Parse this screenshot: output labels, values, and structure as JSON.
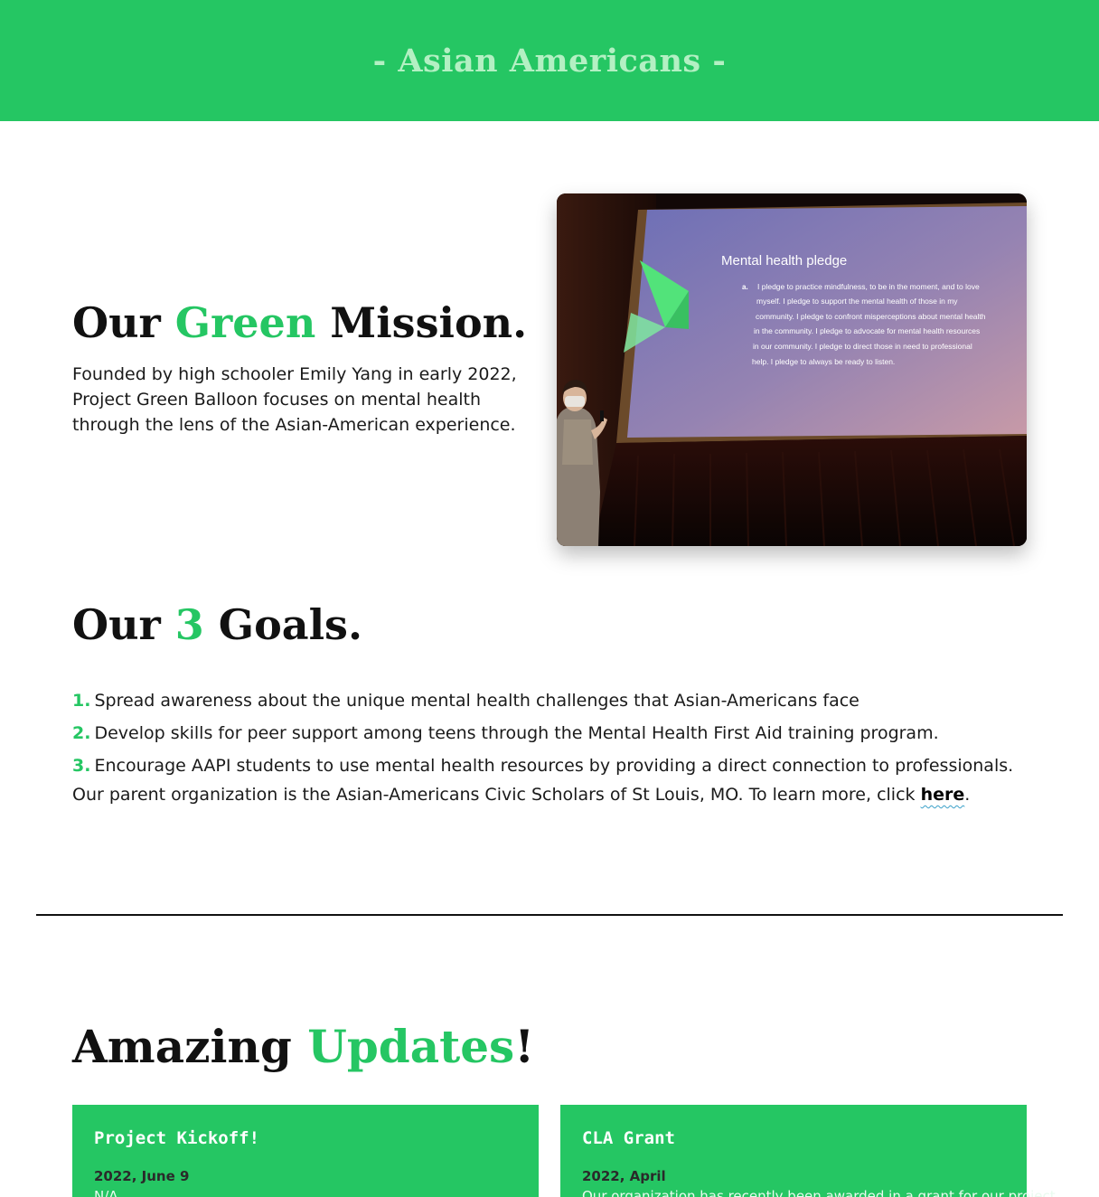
{
  "banner": {
    "title": "- Asian Americans -"
  },
  "mission": {
    "heading_pre": "Our ",
    "heading_accent": "Green",
    "heading_post": " Mission.",
    "body": "Founded by high schooler Emily Yang in early 2022, Project Green Balloon focuses on mental health through the lens of the Asian-American experience."
  },
  "photo": {
    "slide_title": "Mental health pledge",
    "slide_marker": "a.",
    "slide_lines": [
      "I pledge to practice mindfulness, to be in the moment, and to love",
      "myself.  I pledge to support the mental health of those in my",
      "community.  I pledge to confront misperceptions about mental health",
      "in the community.  I pledge to advocate for mental health resources",
      "in our community.  I pledge to direct those in need to professional",
      "help.  I pledge to always be ready to listen."
    ]
  },
  "goals": {
    "heading_pre": "Our ",
    "heading_accent": "3",
    "heading_post": " Goals.",
    "items": [
      {
        "num": "1.",
        "text": "Spread awareness about the unique mental health challenges that Asian-Americans face"
      },
      {
        "num": "2.",
        "text": "Develop skills for peer support among teens through the Mental Health First Aid training program."
      },
      {
        "num": "3.",
        "text": "Encourage AAPI students to use mental health resources by providing a direct connection to professionals."
      }
    ],
    "parent_text": "Our parent organization is the Asian-Americans Civic Scholars of St Louis, MO. To learn more, click ",
    "parent_link": "here",
    "parent_end": "."
  },
  "updates": {
    "heading_pre": "Amazing ",
    "heading_accent": "Updates",
    "heading_post": "!",
    "cards": [
      {
        "title": "Project Kickoff!",
        "date": "2022, June 9",
        "text": "N/A"
      },
      {
        "title": "CLA Grant",
        "date": "2022, April",
        "text": "Our organization has recently been awarded in a grant for our project"
      }
    ]
  },
  "colors": {
    "brand_green": "#25c663",
    "banner_text": "#b3f0c3",
    "link_underline": "#3aa0c8"
  }
}
